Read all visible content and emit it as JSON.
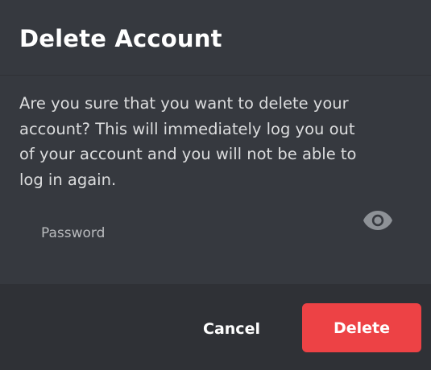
{
  "dialog": {
    "title": "Delete Account",
    "description": "Are you sure that you want to delete your account? This will immediately log you out of your account and you will not be able to log in again.",
    "password_field": {
      "placeholder": "Password",
      "value": "",
      "visibility_icon": "eye-icon"
    },
    "footer": {
      "cancel_label": "Cancel",
      "delete_label": "Delete"
    }
  },
  "colors": {
    "background": "#36393f",
    "footer_background": "#2f3136",
    "danger": "#ed4245",
    "text_primary": "#ffffff",
    "text_secondary": "#dcddde",
    "icon": "#8e9297"
  }
}
